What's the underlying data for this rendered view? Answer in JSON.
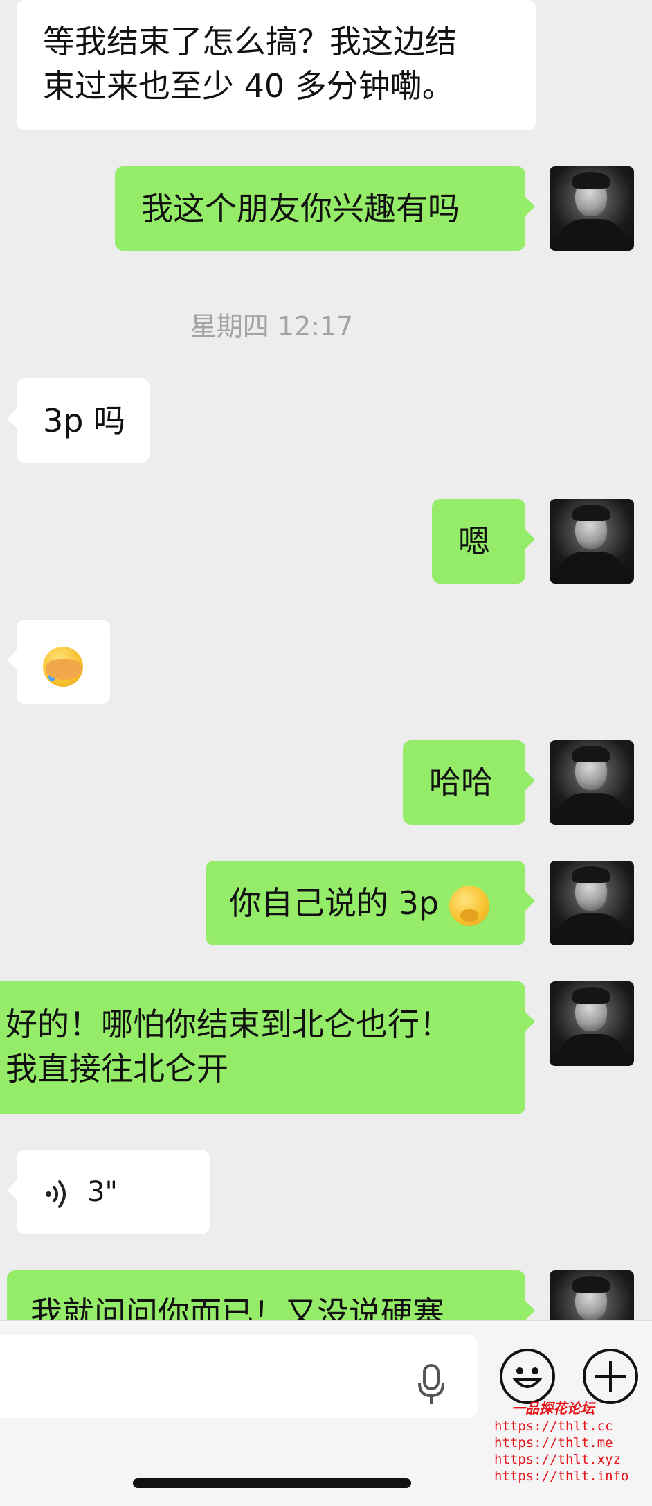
{
  "messages": [
    {
      "side": "in",
      "lines": [
        "等我结束了怎么搞？我这边结",
        "束过来也至少 40 多分钟嘞。"
      ]
    },
    {
      "side": "out",
      "text": "我这个朋友你兴趣有吗"
    },
    {
      "timestamp": "星期四 12:17"
    },
    {
      "side": "in",
      "text": "3p 吗"
    },
    {
      "side": "out",
      "text": "嗯"
    },
    {
      "side": "in",
      "emoji": "facepalm-emoji"
    },
    {
      "side": "out",
      "text": "哈哈"
    },
    {
      "side": "out",
      "text": "你自己说的 3p",
      "emoji": "thinking-emoji"
    },
    {
      "side": "out",
      "lines": [
        "好的！哪怕你结束到北仑也行！",
        "我直接往北仑开"
      ]
    },
    {
      "side": "in",
      "voice_duration": "3\""
    },
    {
      "side": "out",
      "text": "我就问问你而已！又没说硬塞"
    }
  ],
  "input_bar": {
    "icons": [
      "mic-icon",
      "emoji-face-icon",
      "plus-icon"
    ]
  },
  "watermark": {
    "title": "一品探花论坛",
    "lines": [
      "https://thlt.cc",
      "https://thlt.me",
      "https://thlt.xyz",
      "https://thlt.info"
    ],
    "color": "#e5141b"
  },
  "colors": {
    "background": "#ededed",
    "incoming": "#ffffff",
    "outgoing": "#95ec69"
  }
}
